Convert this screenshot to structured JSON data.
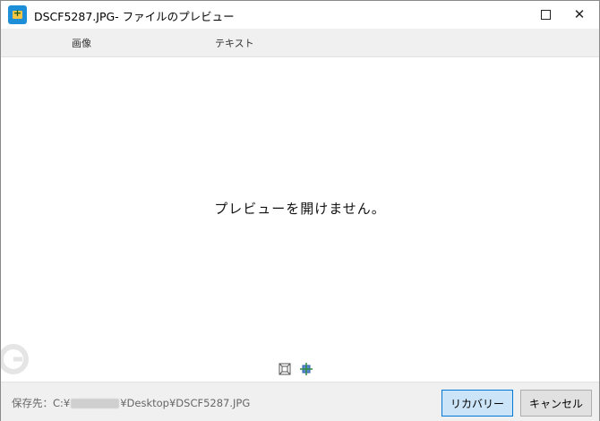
{
  "window": {
    "title": "DSCF5287.JPG- ファイルのプレビュー",
    "app_icon": "toolbox-icon",
    "maximize_icon": "maximize-icon",
    "close_icon": "close-icon",
    "close_glyph": "✕"
  },
  "tabs": [
    {
      "label": "画像"
    },
    {
      "label": "テキスト"
    }
  ],
  "preview": {
    "message": "プレビューを開けません。",
    "tools": [
      "fit-to-window-icon",
      "actual-size-icon"
    ]
  },
  "footer": {
    "save_path_prefix": "保存先：C:¥",
    "save_path_suffix": "¥Desktop¥DSCF5287.JPG",
    "recover_label": "リカバリー",
    "cancel_label": "キャンセル"
  },
  "colors": {
    "accent": "#0078d7",
    "recover_button_bg": "#cce4f7",
    "bar_bg": "#f0f0f0"
  }
}
